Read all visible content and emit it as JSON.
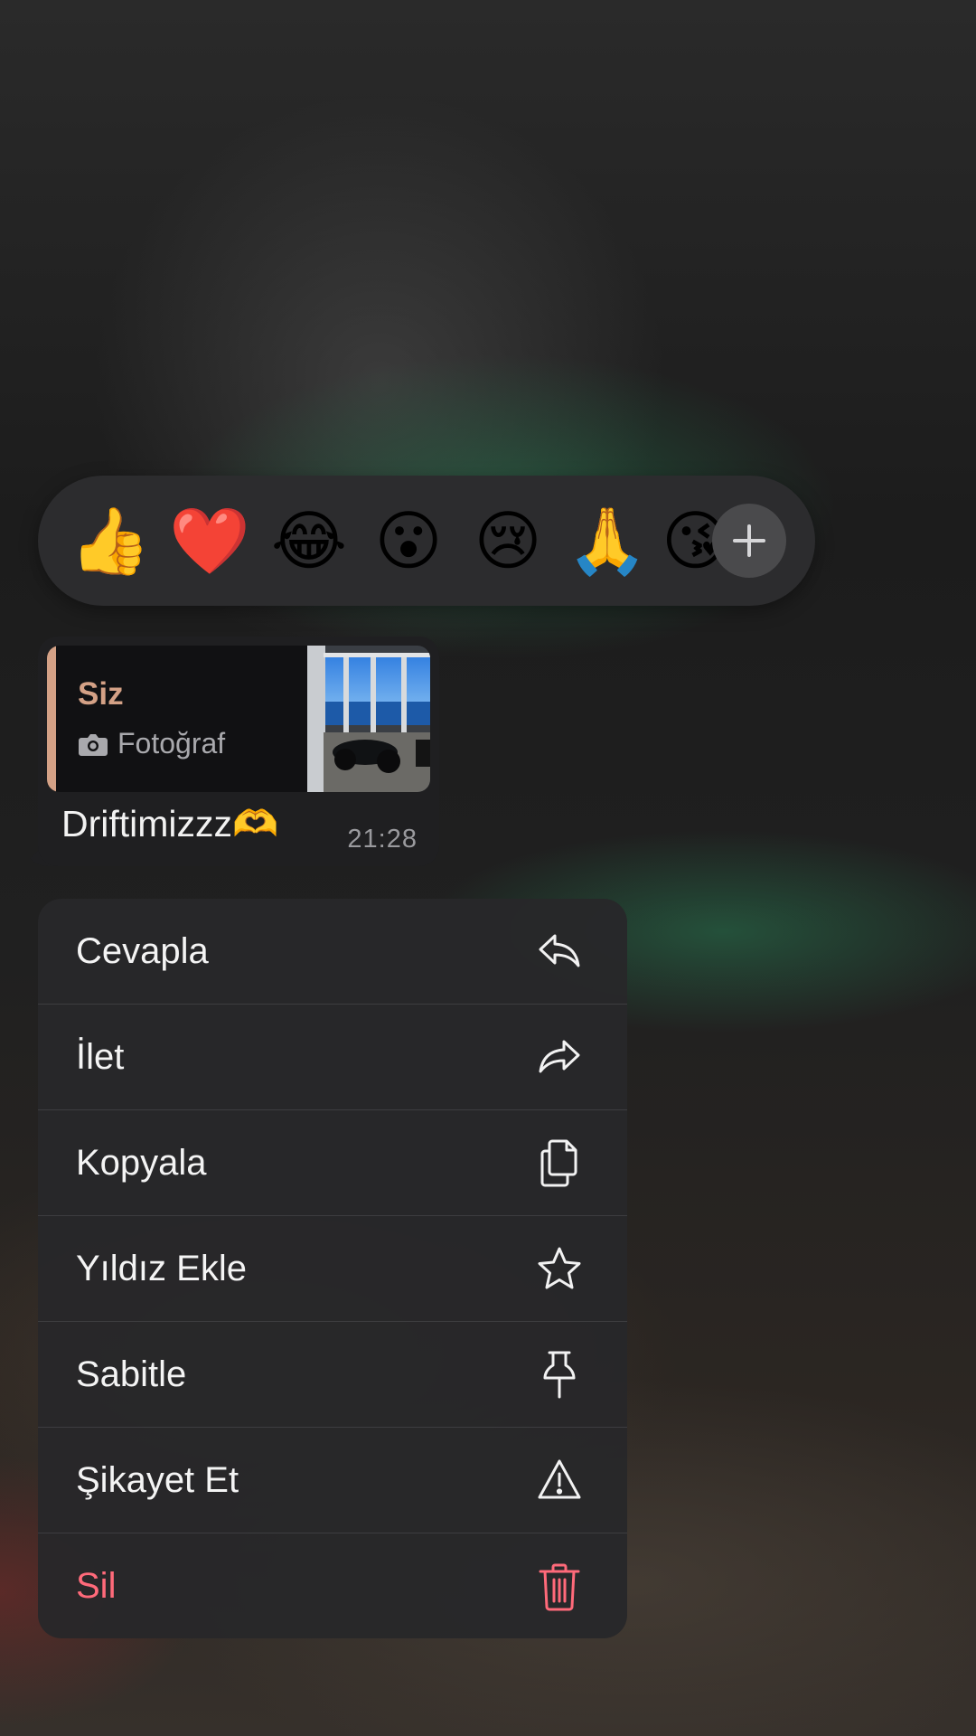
{
  "reactions": {
    "emojis": [
      "👍",
      "❤️",
      "😂",
      "😮",
      "😢",
      "🙏",
      "😘"
    ],
    "more_icon": "plus-icon"
  },
  "message": {
    "quote": {
      "author": "Siz",
      "type_label": "Fotoğraf",
      "type_icon": "camera-icon"
    },
    "text": "Driftimizzz🫶",
    "time": "21:28"
  },
  "menu": {
    "items": [
      {
        "label": "Cevapla",
        "icon": "reply-icon"
      },
      {
        "label": "İlet",
        "icon": "forward-icon"
      },
      {
        "label": "Kopyala",
        "icon": "copy-icon"
      },
      {
        "label": "Yıldız Ekle",
        "icon": "star-icon"
      },
      {
        "label": "Sabitle",
        "icon": "pin-icon"
      },
      {
        "label": "Şikayet Et",
        "icon": "warning-icon"
      },
      {
        "label": "Sil",
        "icon": "trash-icon"
      }
    ]
  },
  "colors": {
    "quote_accent": "#d4a186",
    "danger": "#ff6a7a"
  }
}
